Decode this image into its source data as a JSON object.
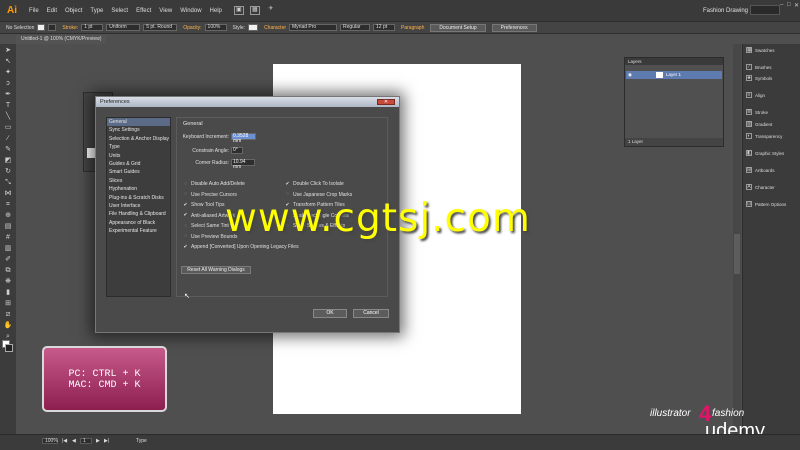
{
  "menubar": {
    "logo": "Ai",
    "items": [
      "File",
      "Edit",
      "Object",
      "Type",
      "Select",
      "Effect",
      "View",
      "Window",
      "Help"
    ],
    "workspace": "Fashion Drawing"
  },
  "controlbar": {
    "selection": "No Selection",
    "stroke_label": "Stroke:",
    "stroke_value": "1 pt",
    "profile_value": "Uniform",
    "brush_value": "5 pt. Round",
    "opacity_label": "Opacity:",
    "opacity_value": "100%",
    "style_label": "Style:",
    "character_label": "Character",
    "font_value": "Myriad Pro",
    "style_value": "Regular",
    "size_value": "12 pt",
    "paragraph_label": "Paragraph",
    "document_setup": "Document Setup",
    "preferences": "Preferences"
  },
  "document": {
    "tab_title": "Untitled-1 @ 100% (CMYK/Preview)"
  },
  "layers_panel": {
    "tab": "Layers",
    "layer_name": "Layer 1",
    "footer": "1 Layer"
  },
  "right_dock": {
    "items": [
      "Swatches",
      "Brushes",
      "Symbols",
      "Align",
      "Stroke",
      "Gradient",
      "Transparency",
      "Graphic Styles",
      "Artboards",
      "Character",
      "Pattern Options"
    ]
  },
  "preferences": {
    "title": "Preferences",
    "categories": [
      "General",
      "Sync Settings",
      "Selection & Anchor Display",
      "Type",
      "Units",
      "Guides & Grid",
      "Smart Guides",
      "Slices",
      "Hyphenation",
      "Plug-ins & Scratch Disks",
      "User Interface",
      "File Handling & Clipboard",
      "Appearance of Black",
      "Experimental Feature"
    ],
    "section_title": "General",
    "keyboard_increment_label": "Keyboard Increment:",
    "keyboard_increment_value": "0.3528 mm",
    "constrain_angle_label": "Constrain Angle:",
    "constrain_angle_value": "0°",
    "corner_radius_label": "Corner Radius:",
    "corner_radius_value": "10.94 mm",
    "options_left": [
      {
        "label": "Disable Auto Add/Delete",
        "checked": false
      },
      {
        "label": "Use Precise Cursors",
        "checked": false
      },
      {
        "label": "Show Tool Tips",
        "checked": true
      },
      {
        "label": "Anti-aliased Artwork",
        "checked": true
      },
      {
        "label": "Select Same Tint %",
        "checked": false
      },
      {
        "label": "Use Preview Bounds",
        "checked": false
      },
      {
        "label": "Append [Converted] Upon Opening Legacy Files",
        "checked": true
      }
    ],
    "options_right": [
      {
        "label": "Double Click To Isolate",
        "checked": true
      },
      {
        "label": "Use Japanese Crop Marks",
        "checked": false
      },
      {
        "label": "Transform Pattern Tiles",
        "checked": true
      },
      {
        "label": "Scale Rectangle Corners",
        "checked": false
      },
      {
        "label": "Scale Strokes & Effects",
        "checked": false
      }
    ],
    "reset_button": "Reset All Warning Dialogs",
    "ok_button": "OK",
    "cancel_button": "Cancel"
  },
  "overlay": {
    "watermark": "www.cgtsj.com",
    "shortcut_pc": "PC: CTRL + K",
    "shortcut_mac": "MAC: CMD + K",
    "brand_illustrator": "illustrator",
    "brand_four": "4",
    "brand_fashion": "fashion",
    "brand_udemy": "udemy"
  },
  "statusbar": {
    "zoom": "100%",
    "page": "1",
    "tool": "Type"
  },
  "colors": {
    "accent_orange": "#ff9a00",
    "badge_pink": "#b03a6e",
    "watermark_yellow": "#ffff00",
    "selection_blue": "#5b6a86"
  }
}
